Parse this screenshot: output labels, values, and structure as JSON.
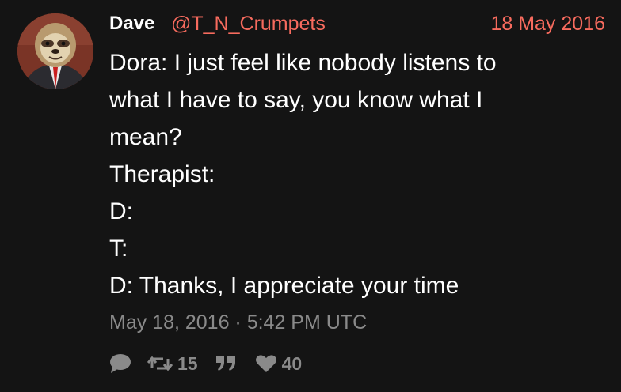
{
  "tweet": {
    "author_name": "Dave",
    "handle": "@T_N_Crumpets",
    "date": "18 May 2016",
    "lines": [
      "Dora: I just feel like nobody listens to",
      "what I have to say, you know what I",
      "mean?",
      "Therapist:",
      "D:",
      "T:",
      "D: Thanks, I appreciate your time"
    ],
    "timestamp": "May 18, 2016 · 5:42 PM UTC",
    "retweet_count": "15",
    "like_count": "40"
  },
  "colors": {
    "background": "#141414",
    "accent": "#f76b5e",
    "muted": "#8a8a8a",
    "text": "#ffffff"
  },
  "icons": {
    "reply": "speech-bubble-icon",
    "retweet": "retweet-icon",
    "quote": "quote-icon",
    "like": "heart-icon"
  }
}
